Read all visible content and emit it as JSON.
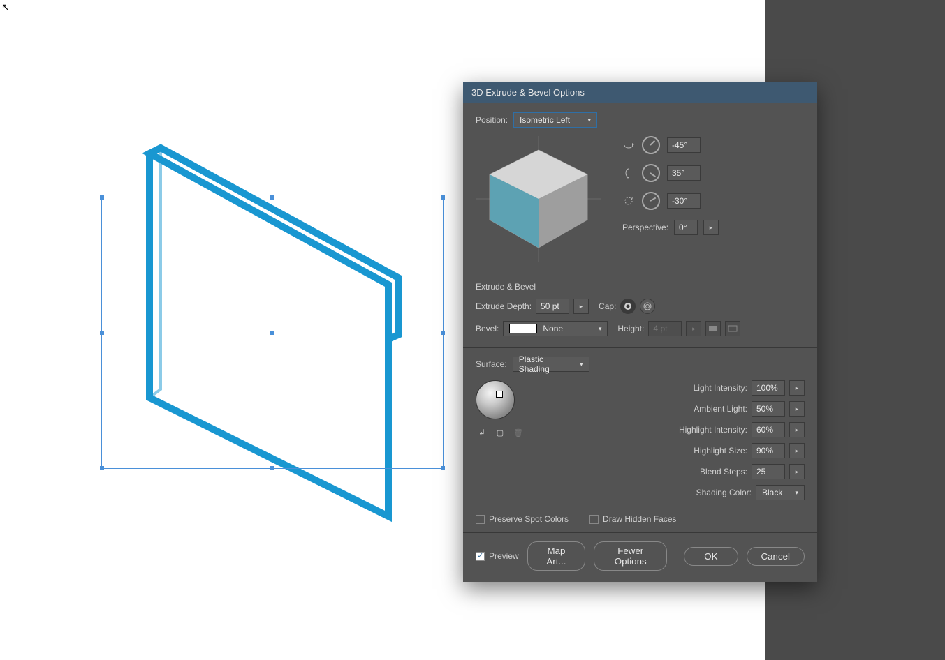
{
  "dialog": {
    "title": "3D Extrude & Bevel Options",
    "position_label": "Position:",
    "position_value": "Isometric Left",
    "rotations": {
      "x": "-45°",
      "y": "35°",
      "z": "-30°"
    },
    "perspective_label": "Perspective:",
    "perspective_value": "0°",
    "extrude_section": "Extrude & Bevel",
    "extrude_depth_label": "Extrude Depth:",
    "extrude_depth_value": "50 pt",
    "cap_label": "Cap:",
    "bevel_label": "Bevel:",
    "bevel_value": "None",
    "height_label": "Height:",
    "height_value": "4 pt",
    "surface_label": "Surface:",
    "surface_value": "Plastic Shading",
    "light_intensity_label": "Light Intensity:",
    "light_intensity_value": "100%",
    "ambient_light_label": "Ambient Light:",
    "ambient_light_value": "50%",
    "highlight_intensity_label": "Highlight Intensity:",
    "highlight_intensity_value": "60%",
    "highlight_size_label": "Highlight Size:",
    "highlight_size_value": "90%",
    "blend_steps_label": "Blend Steps:",
    "blend_steps_value": "25",
    "shading_color_label": "Shading Color:",
    "shading_color_value": "Black",
    "preserve_spot_label": "Preserve Spot Colors",
    "draw_hidden_label": "Draw Hidden Faces",
    "preview_label": "Preview",
    "map_art_label": "Map Art...",
    "fewer_options_label": "Fewer Options",
    "ok_label": "OK",
    "cancel_label": "Cancel"
  },
  "colors": {
    "shape_stroke": "#1997d1",
    "selection": "#4a90d9"
  }
}
